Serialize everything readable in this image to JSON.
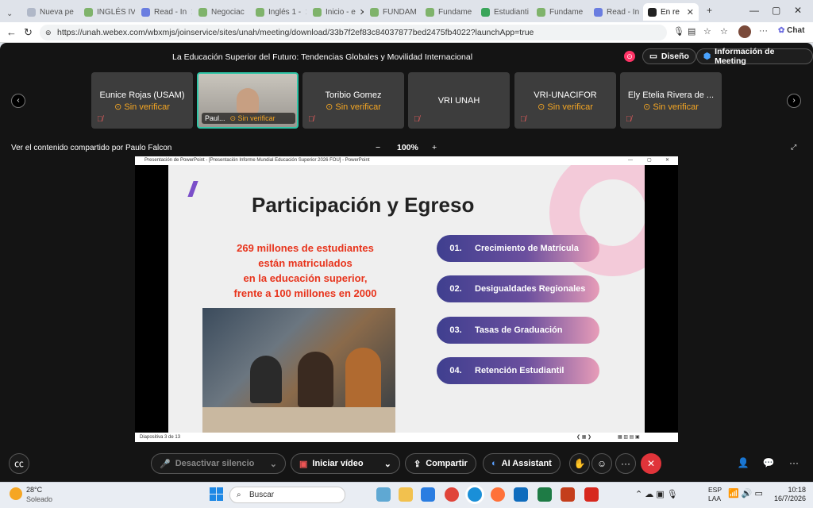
{
  "browser": {
    "tabs": [
      {
        "label": "Nueva pe",
        "color": "#b0b8c8"
      },
      {
        "label": "INGLÉS IV",
        "color": "#7fb36b"
      },
      {
        "label": "Read - In",
        "color": "#6a7de0"
      },
      {
        "label": "Negociac",
        "color": "#7fb36b"
      },
      {
        "label": "Inglés 1 -",
        "color": "#7fb36b"
      },
      {
        "label": "Inicio - e",
        "color": "#7fb36b"
      },
      {
        "label": "FUNDAM",
        "color": "#7fb36b"
      },
      {
        "label": "Fundame",
        "color": "#7fb36b"
      },
      {
        "label": "Estudianti",
        "color": "#3aa55a"
      },
      {
        "label": "Fundame",
        "color": "#7fb36b"
      },
      {
        "label": "Read - In",
        "color": "#6a7de0"
      },
      {
        "label": "En re",
        "color": "#222222"
      }
    ],
    "url": "https://unah.webex.com/wbxmjs/joinservice/sites/unah/meeting/download/33b7f2ef83c84037877bed2475fb4022?launchApp=true",
    "chat_label": "Chat"
  },
  "meeting": {
    "title": "La Educación Superior del Futuro: Tendencias Globales y Movilidad Internacional",
    "design_btn": "Diseño",
    "info_btn": "Información de Meeting",
    "participants": [
      {
        "name": "Eunice Rojas (USAM)",
        "status": "⊙ Sin verificar"
      },
      {
        "name": "Paul...",
        "status": "⊙ Sin verificar"
      },
      {
        "name": "Toribio Gomez",
        "status": "⊙ Sin verificar"
      },
      {
        "name": "VRI UNAH",
        "status": ""
      },
      {
        "name": "VRI-UNACIFOR",
        "status": "⊙ Sin verificar"
      },
      {
        "name": "Ely Etelia Rivera de ...",
        "status": "⊙ Sin verificar"
      }
    ],
    "share_label": "Ver el contenido compartido por Paulo Falcon",
    "zoom": "100%"
  },
  "ppt": {
    "window_title": "Presentación de PowerPoint - [Presentación Informe Mundial Educación Superior 2026 FOU] - PowerPoint",
    "slide_title": "Participación y Egreso",
    "stat_lines": [
      "269 millones de estudiantes",
      "están matriculados",
      "en la educación superior,",
      "frente a 100 millones en 2000"
    ],
    "items": [
      {
        "num": "01.",
        "label": "Crecimiento de Matrícula"
      },
      {
        "num": "02.",
        "label": "Desigualdades Regionales"
      },
      {
        "num": "03.",
        "label": "Tasas de Graduación"
      },
      {
        "num": "04.",
        "label": "Retención Estudiantil"
      }
    ],
    "footer": "Diapositiva 3 de 13"
  },
  "controls": {
    "mute": "Desactivar silencio",
    "video": "Iniciar vídeo",
    "share": "Compartir",
    "ai": "AI Assistant"
  },
  "taskbar": {
    "weather_temp": "28°C",
    "weather_desc": "Soleado",
    "search": "Buscar",
    "lang1": "ESP",
    "lang2": "LAA",
    "time": "10:18",
    "date": "16/7/2026"
  }
}
